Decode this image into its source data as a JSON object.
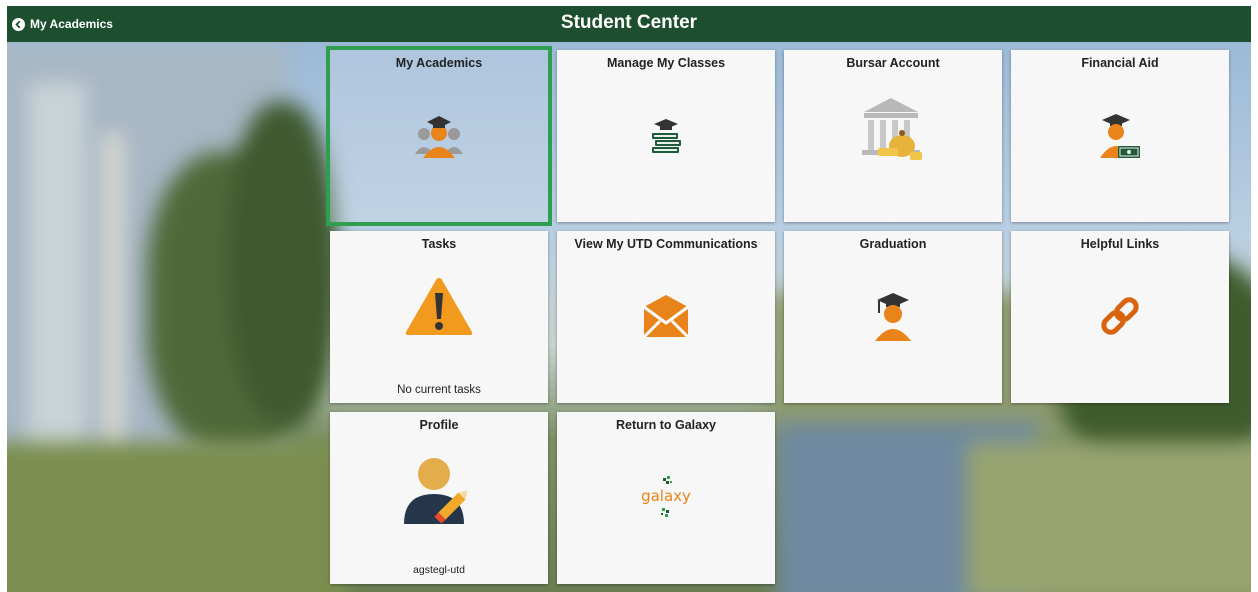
{
  "header": {
    "back_label": "My Academics",
    "title": "Student Center"
  },
  "tiles": [
    {
      "title": "My Academics",
      "icon": "graduate-group-icon",
      "selected": true
    },
    {
      "title": "Manage My Classes",
      "icon": "books-graduation-cap-icon"
    },
    {
      "title": "Bursar Account",
      "icon": "bank-money-icon"
    },
    {
      "title": "Financial Aid",
      "icon": "graduate-money-icon"
    },
    {
      "title": "Tasks",
      "icon": "warning-icon",
      "subtitle": "No current tasks"
    },
    {
      "title": "View My UTD Communications",
      "icon": "envelope-icon"
    },
    {
      "title": "Graduation",
      "icon": "graduate-icon"
    },
    {
      "title": "Helpful Links",
      "icon": "link-icon"
    },
    {
      "title": "Profile",
      "icon": "user-edit-icon",
      "subtitle": "agstegl-utd"
    },
    {
      "title": "Return to Galaxy",
      "icon": "galaxy-logo",
      "logo_text": "galaxy"
    }
  ],
  "colors": {
    "header_bg": "#1d4f2e",
    "selected_outline": "#2e9e4f",
    "icon_orange": "#e8841a",
    "icon_green": "#1f5a3a"
  }
}
